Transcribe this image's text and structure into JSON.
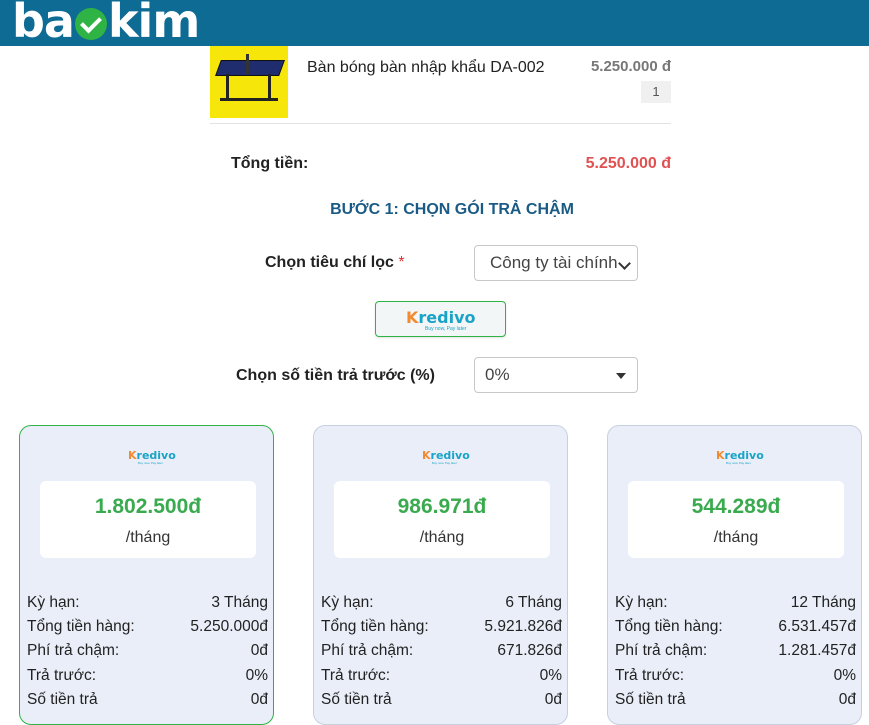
{
  "header": {
    "logo_left": "ba",
    "logo_right": "kim"
  },
  "product": {
    "name": "Bàn bóng bàn nhập khẩu DA-002",
    "price": "5.250.000 đ",
    "qty": "1"
  },
  "total": {
    "label": "Tổng tiền:",
    "value": "5.250.000 đ"
  },
  "step": {
    "title": "BƯỚC 1: CHỌN GÓI TRẢ CHẬM"
  },
  "filter": {
    "label": "Chọn tiêu chí lọc",
    "required": "*",
    "value": "Công ty tài chính"
  },
  "provider": {
    "name_k": "K",
    "name_rest": "redivo",
    "tagline": "Buy now, Pay later"
  },
  "downpayment": {
    "label": "Chọn số tiền trả trước (%)",
    "value": "0%"
  },
  "colors": {
    "header_bg": "#0e6b94",
    "accent_green": "#2fb344",
    "price_red": "#e05252",
    "step_blue": "#1a5b86"
  },
  "plans": [
    {
      "amount": "1.802.500đ",
      "per": "/tháng",
      "rows": [
        {
          "label": "Kỳ hạn:",
          "value": "3 Tháng"
        },
        {
          "label": "Tổng tiền hàng:",
          "value": "5.250.000đ"
        },
        {
          "label": "Phí trả chậm:",
          "value": "0đ"
        },
        {
          "label": "Trả trước:",
          "value": "0%"
        },
        {
          "label": "Số tiền trả",
          "value": "0đ"
        }
      ]
    },
    {
      "amount": "986.971đ",
      "per": "/tháng",
      "rows": [
        {
          "label": "Kỳ hạn:",
          "value": "6 Tháng"
        },
        {
          "label": "Tổng tiền hàng:",
          "value": "5.921.826đ"
        },
        {
          "label": "Phí trả chậm:",
          "value": "671.826đ"
        },
        {
          "label": "Trả trước:",
          "value": "0%"
        },
        {
          "label": "Số tiền trả",
          "value": "0đ"
        }
      ]
    },
    {
      "amount": "544.289đ",
      "per": "/tháng",
      "rows": [
        {
          "label": "Kỳ hạn:",
          "value": "12 Tháng"
        },
        {
          "label": "Tổng tiền hàng:",
          "value": "6.531.457đ"
        },
        {
          "label": "Phí trả chậm:",
          "value": "1.281.457đ"
        },
        {
          "label": "Trả trước:",
          "value": "0%"
        },
        {
          "label": "Số tiền trả",
          "value": "0đ"
        }
      ]
    }
  ]
}
